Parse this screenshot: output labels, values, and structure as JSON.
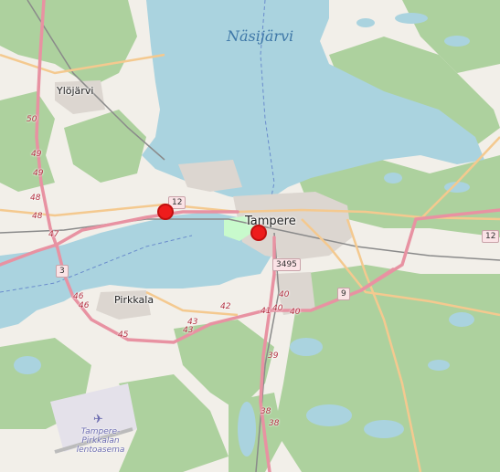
{
  "map": {
    "lake_label": "Näsijärvi",
    "places": {
      "ylojarvi": "Ylöjärvi",
      "tampere": "Tampere",
      "pirkkala": "Pirkkala"
    },
    "airport": {
      "label": "Tampere-\nPirkkalan\nlentoasema",
      "icon": "airplane-icon"
    },
    "route_shields": {
      "r12_west": "12",
      "r12_east": "12",
      "r3": "3",
      "r3495": "3495",
      "r9": "9"
    },
    "junction_numbers": {
      "j50": "50",
      "j49a": "49",
      "j49b": "49",
      "j48a": "48",
      "j48b": "48",
      "j47": "47",
      "j46a": "46",
      "j46b": "46",
      "j45": "45",
      "j43a": "43",
      "j43b": "43",
      "j42": "42",
      "j41": "41",
      "j40a": "40",
      "j40b": "40",
      "j40c": "40",
      "j39": "39",
      "j38a": "38",
      "j38b": "38"
    },
    "markers": [
      {
        "name": "marker-west"
      },
      {
        "name": "marker-tampere"
      }
    ],
    "colors": {
      "water": "#aad3df",
      "forest": "#add19e",
      "land": "#f2efe9",
      "motorway": "#e892a2",
      "marker": "#ee1c1c"
    }
  }
}
